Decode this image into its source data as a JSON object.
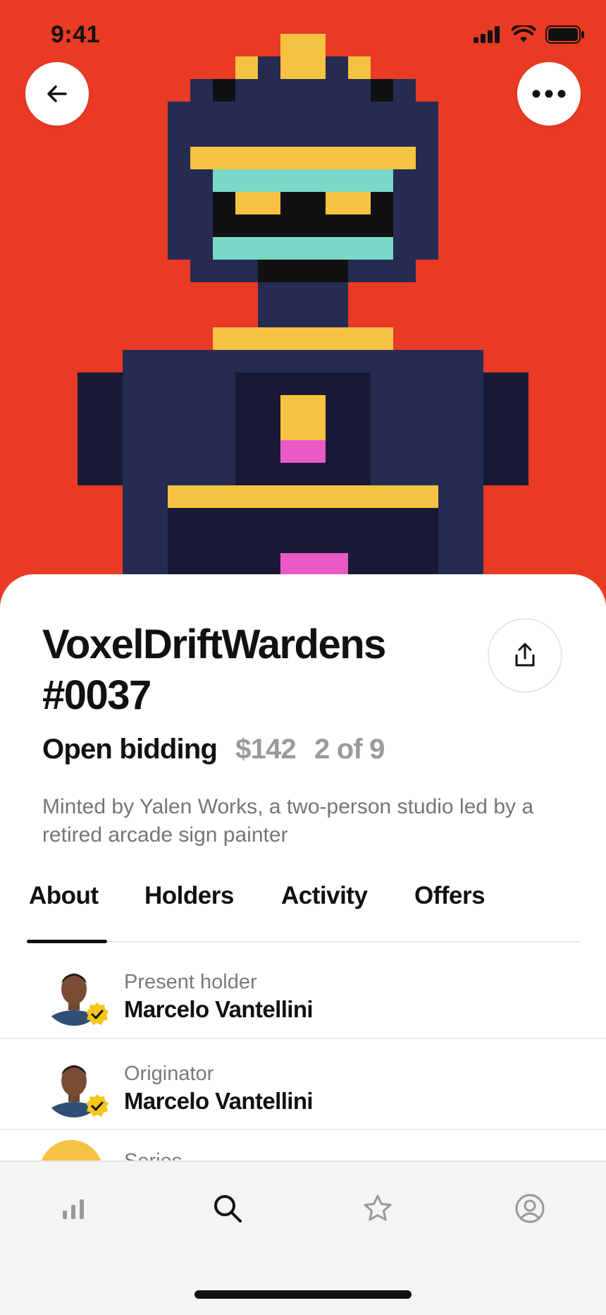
{
  "status_bar": {
    "time": "9:41"
  },
  "header": {
    "back_icon": "arrow-left-icon",
    "more_icon": "ellipsis-horizontal-icon"
  },
  "artwork": {
    "description_icon": "pixel-robot-artwork",
    "background_color": "#e93a24"
  },
  "item": {
    "title": "VoxelDriftWardens #0037",
    "sale_status": "Open bidding",
    "price": "$142",
    "edition": "2 of 9",
    "description": "Minted by Yalen Works, a two-person studio led by a retired arcade sign painter"
  },
  "tabs": [
    {
      "label": "About",
      "active": true
    },
    {
      "label": "Holders",
      "active": false
    },
    {
      "label": "Activity",
      "active": false
    },
    {
      "label": "Offers",
      "active": false
    }
  ],
  "details": [
    {
      "label": "Present holder",
      "name": "Marcelo Vantellini",
      "verified": true
    },
    {
      "label": "Originator",
      "name": "Marcelo Vantellini",
      "verified": true
    },
    {
      "label": "Series",
      "name": "",
      "verified": false
    }
  ],
  "bottom_nav": [
    {
      "icon": "bar-chart-icon",
      "active": false
    },
    {
      "icon": "search-icon",
      "active": true
    },
    {
      "icon": "star-icon",
      "active": false
    },
    {
      "icon": "profile-icon",
      "active": false
    }
  ],
  "colors": {
    "accent_yellow": "#f5c242",
    "robot_navy": "#262b52",
    "robot_dark": "#181a35",
    "teal": "#7ad8c7",
    "pink": "#e95ac7",
    "verified_badge": "#f5c518"
  }
}
